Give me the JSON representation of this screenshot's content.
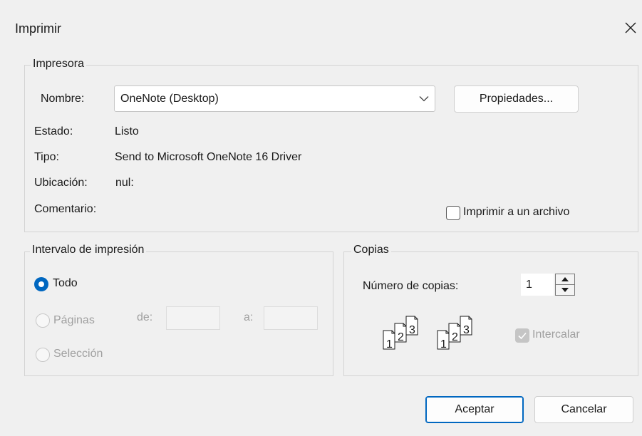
{
  "window": {
    "title": "Imprimir",
    "close_icon": "close-icon"
  },
  "printer_group": {
    "legend": "Impresora",
    "name_label": "Nombre:",
    "name_value": "OneNote (Desktop)",
    "properties_button": "Propiedades...",
    "status_label": "Estado:",
    "status_value": "Listo",
    "type_label": "Tipo:",
    "type_value": "Send to Microsoft OneNote 16 Driver",
    "location_label": "Ubicación:",
    "location_value": "nul:",
    "comment_label": "Comentario:",
    "comment_value": "",
    "print_to_file_label": "Imprimir a un archivo",
    "print_to_file_checked": false
  },
  "range_group": {
    "legend": "Intervalo de impresión",
    "all_label": "Todo",
    "all_selected": true,
    "pages_label": "Páginas",
    "from_label": "de:",
    "from_value": "",
    "to_label": "a:",
    "to_value": "",
    "selection_label": "Selección"
  },
  "copies_group": {
    "legend": "Copias",
    "count_label": "Número de copias:",
    "count_value": "1",
    "collate_label": "Intercalar",
    "collate_checked": true,
    "collate_icon": "collate-pages-icon",
    "page_numbers": [
      "1",
      "2",
      "3"
    ]
  },
  "footer": {
    "ok_button": "Aceptar",
    "cancel_button": "Cancelar"
  },
  "colors": {
    "accent": "#0067c0",
    "background": "#f0f0f0",
    "disabled_text": "#a0a0a0"
  }
}
